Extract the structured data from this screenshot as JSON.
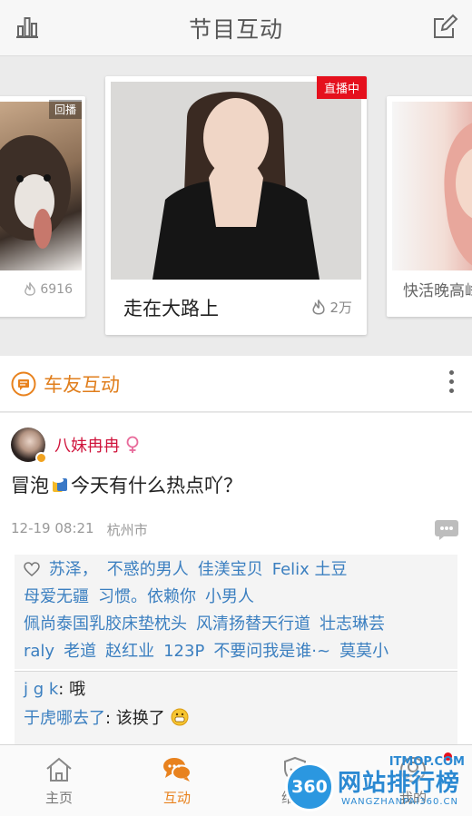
{
  "header": {
    "title": "节目互动",
    "left_icon": "bar-chart-icon",
    "right_icon": "edit-icon"
  },
  "carousel": {
    "left": {
      "tag": "回播",
      "heat": "6916"
    },
    "center": {
      "tag": "直播中",
      "name": "走在大路上",
      "heat": "2万"
    },
    "right": {
      "name": "快活晚高峰"
    }
  },
  "section": {
    "label": "车友互动"
  },
  "post": {
    "username": "八妹冉冉",
    "gender": "female",
    "content_before": "冒泡",
    "content_after": "今天有什么热点吖？",
    "time": "12-19 08:21",
    "location": "杭州市",
    "likes": [
      [
        "苏泽，",
        "不惑的男人",
        "佳渼宝贝",
        "Felix 土豆"
      ],
      [
        "母爱无疆",
        "习惯。依赖你",
        "小男人"
      ],
      [
        "佩尚泰国乳胶床垫枕头",
        "风清扬替天行道",
        "壮志琳芸"
      ],
      [
        "raly",
        "老道",
        "赵红业",
        "123P",
        "不要问我是谁·~",
        "莫莫小"
      ]
    ],
    "comments": [
      {
        "user": "j g k",
        "text": "哦"
      },
      {
        "user": "于虎哪去了",
        "text": "该换了"
      }
    ]
  },
  "tabbar": {
    "tabs": [
      {
        "label": "主页",
        "icon": "home-icon"
      },
      {
        "label": "互动",
        "icon": "chat-icon",
        "active": true
      },
      {
        "label": "维权",
        "icon": "shield-icon"
      },
      {
        "label": "我的",
        "icon": "user-icon"
      }
    ]
  },
  "watermark": {
    "logo": "360",
    "text": "网站排行榜",
    "brand": "ITMOP.COM",
    "sub": "WANGZHANPAI360.CN"
  },
  "colors": {
    "accent": "#e8821e",
    "live_red": "#e5101d",
    "username": "#d0143c",
    "link_blue": "#3b7fc0"
  }
}
